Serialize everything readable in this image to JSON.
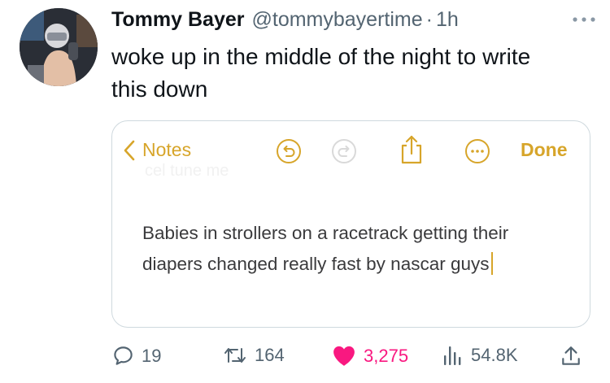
{
  "tweet": {
    "author_name": "Tommy Bayer",
    "handle": "@tommybayertime",
    "separator": "·",
    "time": "1h",
    "text": "woke up in the middle of the night to write this down"
  },
  "notes_screenshot": {
    "back_label": "Notes",
    "done_label": "Done",
    "ghost_text": "cel tune me",
    "body": "Babies in strollers on a racetrack getting their diapers changed really fast by nascar guys",
    "accent_color": "#d7a52a"
  },
  "actions": {
    "replies": "19",
    "retweets": "164",
    "likes": "3,275",
    "views": "54.8K"
  },
  "colors": {
    "text": "#0f1419",
    "muted": "#536471",
    "like": "#f91880",
    "border": "#cfd9de"
  }
}
